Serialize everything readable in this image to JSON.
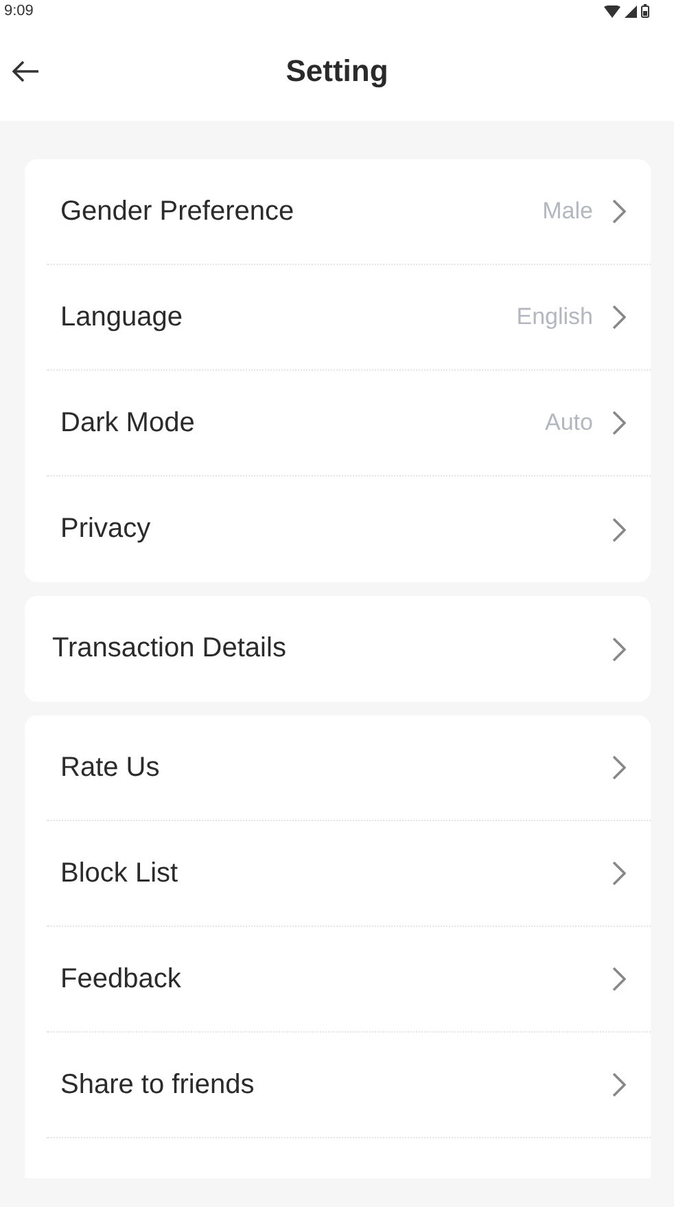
{
  "status_bar": {
    "time": "9:09"
  },
  "header": {
    "title": "Setting"
  },
  "sections": [
    {
      "items": [
        {
          "label": "Gender Preference",
          "value": "Male"
        },
        {
          "label": "Language",
          "value": "English"
        },
        {
          "label": "Dark Mode",
          "value": "Auto"
        },
        {
          "label": "Privacy"
        }
      ]
    },
    {
      "items": [
        {
          "label": "Transaction Details"
        }
      ]
    },
    {
      "items": [
        {
          "label": "Rate Us"
        },
        {
          "label": "Block List"
        },
        {
          "label": "Feedback"
        },
        {
          "label": "Share to friends"
        }
      ]
    }
  ]
}
